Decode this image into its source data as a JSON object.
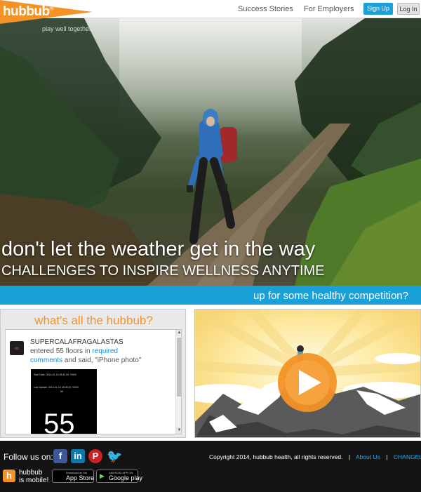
{
  "brand": {
    "name": "hubbub",
    "tagline": "play well together.",
    "accent": "#f39326",
    "blue": "#1aa0d8"
  },
  "nav": {
    "success": "Success Stories",
    "employers": "For Employers",
    "signup": "Sign Up",
    "login": "Log In"
  },
  "hero": {
    "title": "don't let the weather get in the way",
    "subtitle": "CHALLENGES TO INSPIRE WELLNESS ANYTIME"
  },
  "bar": {
    "text": "up for some healthy competition?"
  },
  "feed": {
    "title": "what's all the hubbub?",
    "item": {
      "user": "SUPERCALAFRAGALASTAS",
      "text_1": "entered 55 floors in",
      "link_1": "required",
      "link_2": "comments",
      "text_2": "and said, \"iPhone photo\"",
      "photo_line_1": "Start Date: 2014-01-16 08:42:26 +0000",
      "photo_line_2": "Last Update: 2014-01-16 18:05:29 +0000",
      "photo_line_3": "55",
      "photo_number": "55"
    }
  },
  "footer": {
    "follow": "Follow us on:",
    "copyright": "Copyright 2014, hubbub health, all rights reserved.",
    "about": "About Us",
    "changelog": "CHANGELOG",
    "mobile_line1": "hubbub",
    "mobile_line2": "is mobile!",
    "appstore_small": "Download on the",
    "appstore_big": "App Store",
    "play_small": "ANDROID APP ON",
    "play_big": "Google play"
  },
  "icons": {
    "facebook": "facebook-icon",
    "linkedin": "linkedin-icon",
    "pinterest": "pinterest-icon",
    "twitter": "twitter-icon",
    "play": "play-icon",
    "apple": "apple-icon",
    "google-play": "google-play-icon"
  }
}
